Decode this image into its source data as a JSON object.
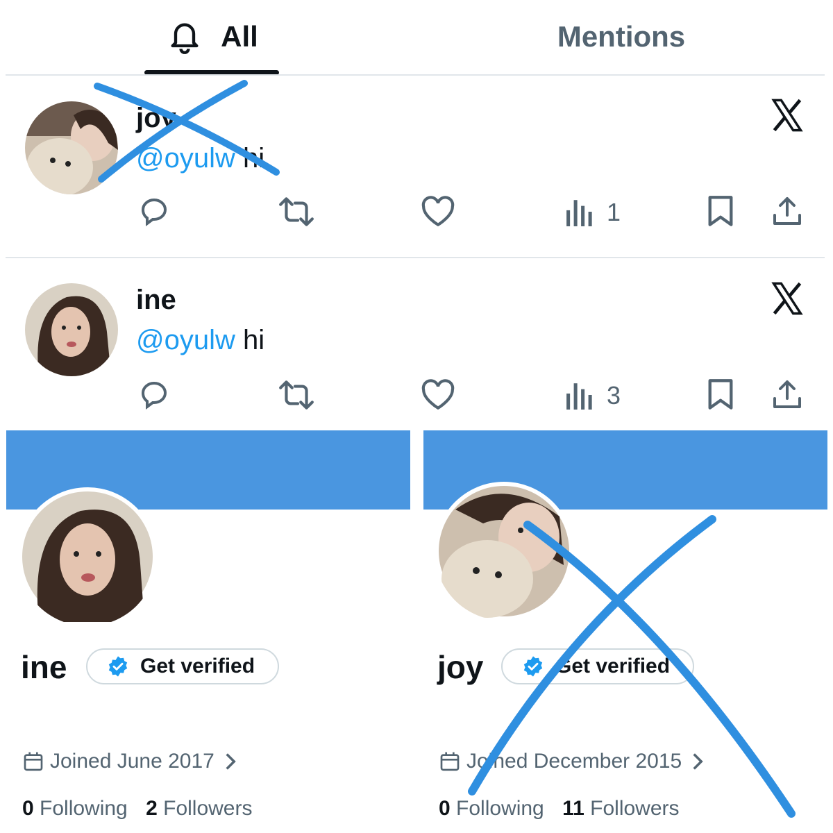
{
  "tabs": {
    "all": "All",
    "mentions": "Mentions"
  },
  "notifications": [
    {
      "name": "joy",
      "handle": "@oyulw",
      "text": " hi",
      "views": "1",
      "crossed_out": true
    },
    {
      "name": "ine",
      "handle": "@oyulw",
      "text": " hi",
      "views": "3",
      "crossed_out": false
    }
  ],
  "profiles": [
    {
      "name": "ine",
      "verify_label": "Get verified",
      "joined": "Joined June 2017",
      "following_count": "0",
      "following_label": " Following",
      "followers_count": "2",
      "followers_label": " Followers",
      "crossed_out": false
    },
    {
      "name": "joy",
      "verify_label": "Get verified",
      "joined": "Joined December 2015",
      "following_count": "0",
      "following_label": " Following",
      "followers_count": "11",
      "followers_label": " Followers",
      "crossed_out": true
    }
  ],
  "colors": {
    "accent": "#1d9bf0",
    "banner": "#4a96e0",
    "cross_mark": "#2f8fe0"
  },
  "icons": [
    "bell-icon",
    "x-logo-icon",
    "reply-icon",
    "retweet-icon",
    "like-icon",
    "views-icon",
    "bookmark-icon",
    "share-icon",
    "verified-badge-icon",
    "calendar-icon",
    "chevron-right-icon"
  ]
}
